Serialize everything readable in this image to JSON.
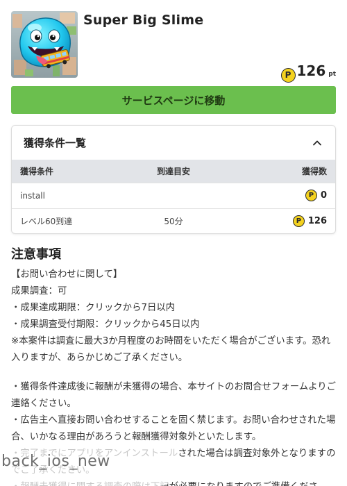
{
  "app": {
    "title": "Super Big Slime",
    "points_value": "126",
    "points_unit": "pt",
    "coin_glyph": "P",
    "icon_name": "slime-app-icon"
  },
  "service_button": {
    "label": "サービスページに移動"
  },
  "conditions": {
    "title": "獲得条件一覧",
    "columns": {
      "condition": "獲得条件",
      "target": "到達目安",
      "reward": "獲得数"
    },
    "rows": [
      {
        "condition": "install",
        "target": "",
        "reward": "0"
      },
      {
        "condition": "レベル60到達",
        "target": "50分",
        "reward": "126"
      }
    ]
  },
  "notes": {
    "title": "注意事項",
    "lines": [
      "【お問い合わせに関して】",
      "成果調査：可",
      "・成果達成期限：クリックから7日以内",
      "・成果調査受付期限：クリックから45日以内",
      "※本案件は調査に最大3か月程度のお時間をいただく場合がございます。恐れ入りますが、あらかじめご了承ください。",
      "・獲得条件達成後に報酬が未獲得の場合、本サイトのお問合せフォームよりご連絡ください。",
      "・広告主へ直接お問い合わせすることを固く禁じます。お問い合わせされた場合、いかなる理由があろうと報酬獲得対象外といたします。",
      "・完了までにアプリをアンインストールされた場合は調査対象外となりますのでご了承ください。",
      "・報酬未獲得に関する調査の際は下記が必要になりますのでご準備くださ"
    ]
  },
  "overlay": {
    "back_label": "back_ios_new"
  },
  "colors": {
    "accent_green": "#6bbf4e",
    "coin_yellow": "#f4d21f",
    "table_header_bg": "#e2e4e8"
  }
}
